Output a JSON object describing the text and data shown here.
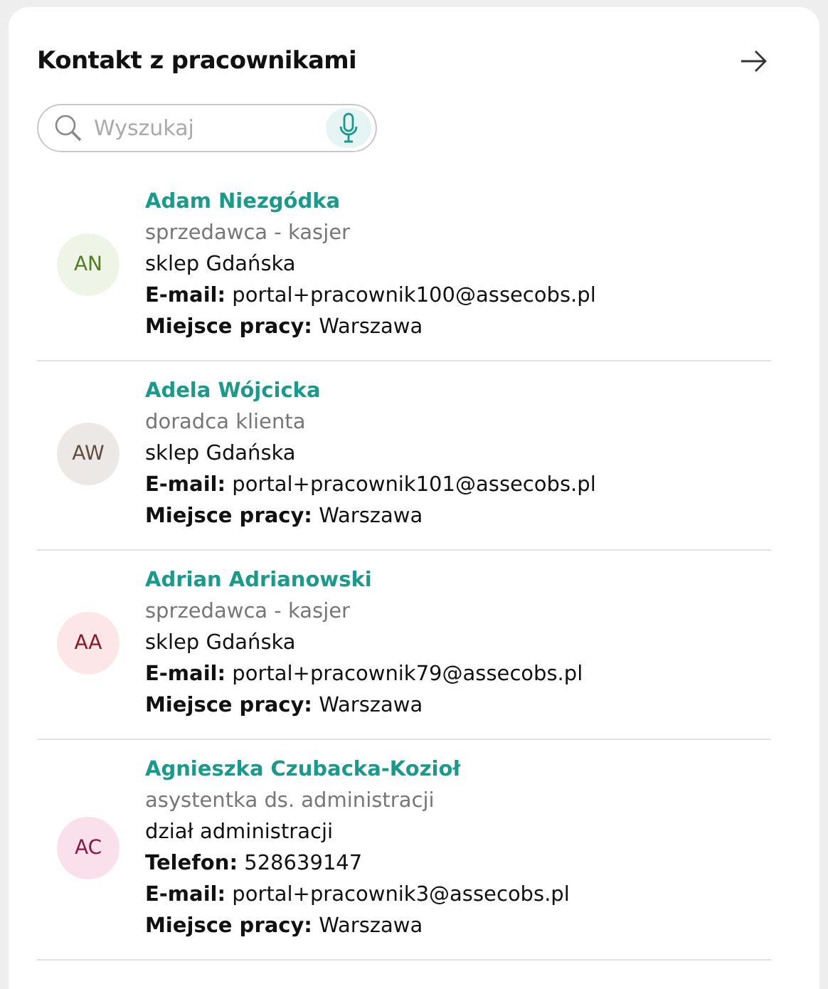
{
  "title": "Kontakt z pracownikami",
  "search": {
    "placeholder": "Wyszukaj"
  },
  "employees": [
    {
      "initials": "AN",
      "color": "#eef5e6",
      "name": "Adam Niezgódka",
      "role": "sprzedawca - kasjer",
      "unit": "sklep Gdańska",
      "details": [
        "**E-mail:** portal+pracownik100@assecobs.pl",
        "**Miejsce pracy:** Warszawa"
      ]
    },
    {
      "initials": "AW",
      "color": "#ece8e6",
      "name": "Adela Wójcicka",
      "role": "doradca klienta",
      "unit": "sklep Gdańska",
      "details": [
        "**E-mail:** portal+pracownik101@assecobs.pl",
        "**Miejsce pracy:** Warszawa"
      ]
    },
    {
      "initials": "AA",
      "color": "#fde6e8",
      "name": "Adrian Adrianowski",
      "role": "sprzedawca - kasjer",
      "unit": "sklep Gdańska",
      "details": [
        "**E-mail:** portal+pracownik79@assecobs.pl",
        "**Miejsce pracy:** Warszawa"
      ]
    },
    {
      "initials": "AC",
      "color": "#fae0ea",
      "name": "Agnieszka Czubacka-Kozioł",
      "role": "asystentka ds. administracji",
      "unit": "dział administracji",
      "details": [
        "**Telefon:** 528639147",
        "**E-mail:** portal+pracownik3@assecobs.pl",
        "**Miejsce pracy:** Warszawa"
      ]
    }
  ]
}
